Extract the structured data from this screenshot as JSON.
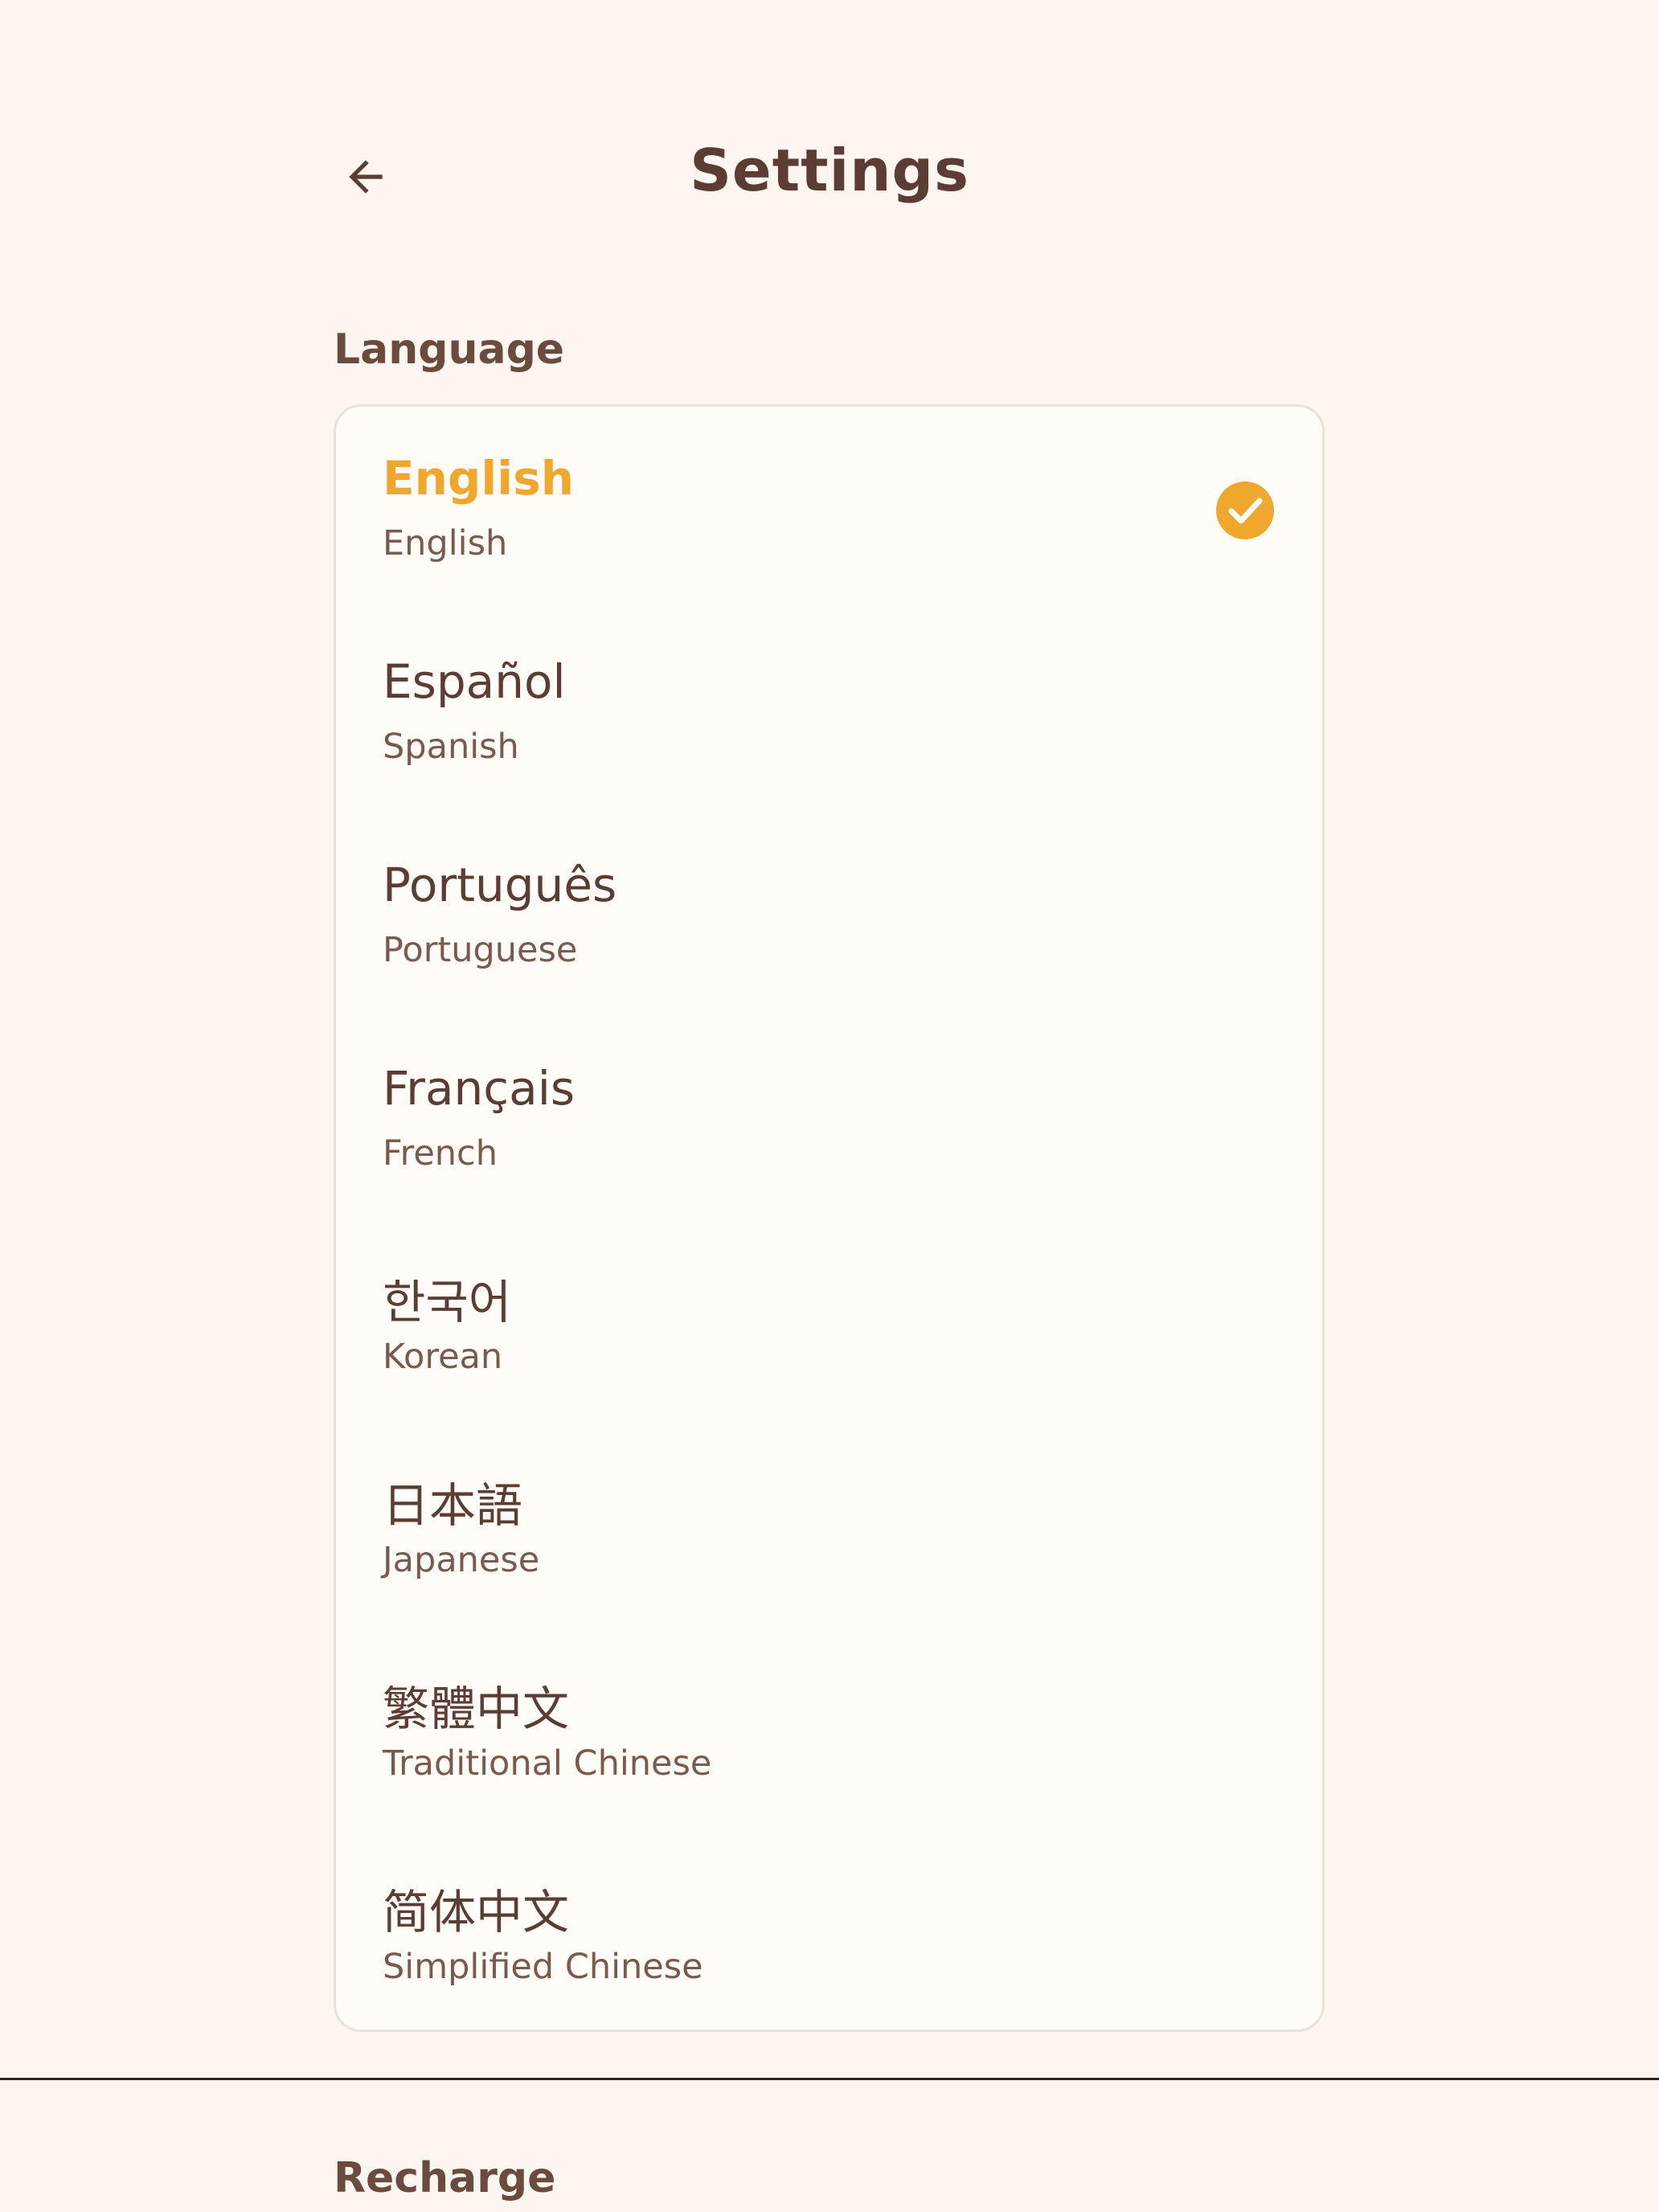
{
  "header": {
    "title": "Settings",
    "back_icon": "arrow-left-icon"
  },
  "sections": {
    "language": {
      "label": "Language",
      "selected_index": 0,
      "items": [
        {
          "native": "English",
          "english": "English"
        },
        {
          "native": "Español",
          "english": "Spanish"
        },
        {
          "native": "Português",
          "english": "Portuguese"
        },
        {
          "native": "Français",
          "english": "French"
        },
        {
          "native": "한국어",
          "english": "Korean"
        },
        {
          "native": "日本語",
          "english": "Japanese"
        },
        {
          "native": "繁體中文",
          "english": "Traditional Chinese"
        },
        {
          "native": "简体中文",
          "english": "Simplified Chinese"
        }
      ]
    },
    "recharge": {
      "label": "Recharge"
    }
  },
  "colors": {
    "background": "#fdf6ee",
    "card": "#fffcf7",
    "accent": "#f0a72e",
    "text_primary": "#5b3d35",
    "text_secondary": "#7a5a4f"
  }
}
